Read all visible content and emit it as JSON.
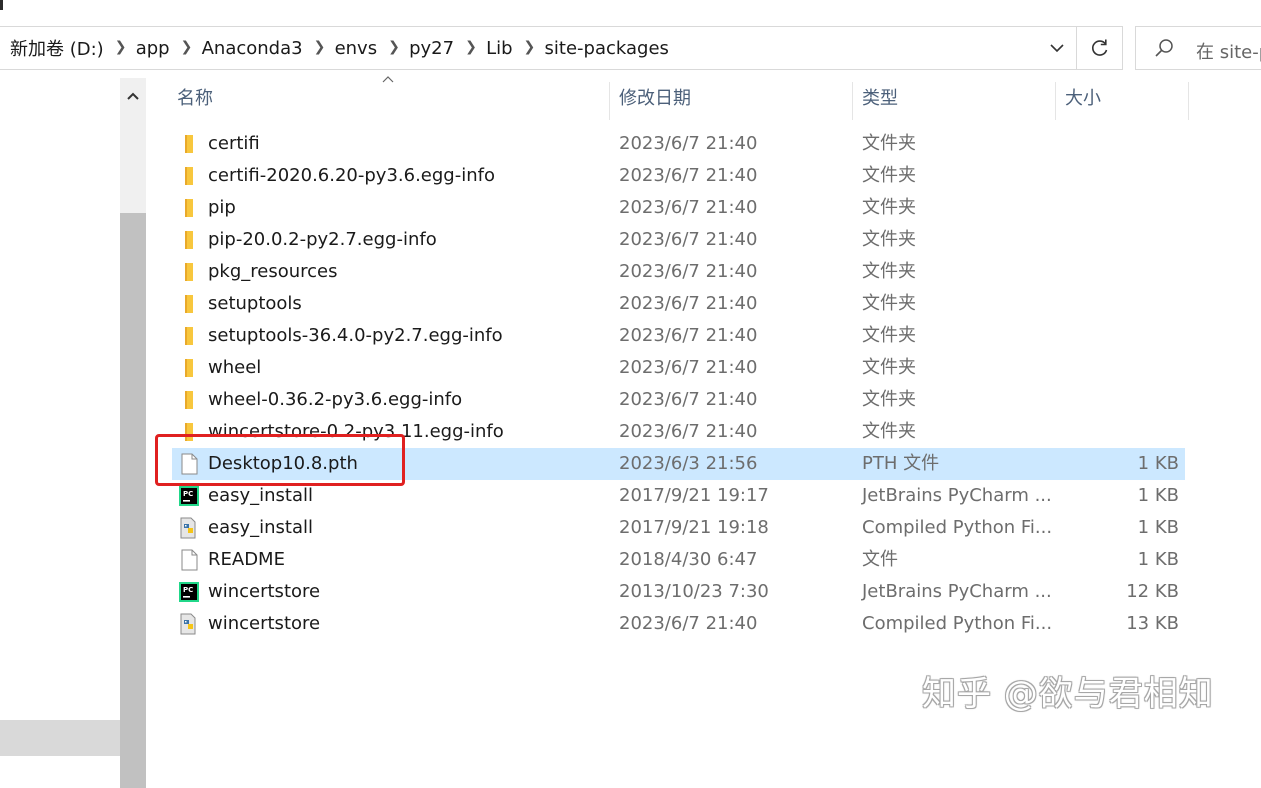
{
  "breadcrumb": [
    "新加卷 (D:)",
    "app",
    "Anaconda3",
    "envs",
    "py27",
    "Lib",
    "site-packages"
  ],
  "search": {
    "placeholder": "在 site-p"
  },
  "columns": {
    "name": "名称",
    "date": "修改日期",
    "type": "类型",
    "size": "大小"
  },
  "files": [
    {
      "name": "certifi",
      "date": "2023/6/7 21:40",
      "type": "文件夹",
      "size": "",
      "icon": "folder-icon"
    },
    {
      "name": "certifi-2020.6.20-py3.6.egg-info",
      "date": "2023/6/7 21:40",
      "type": "文件夹",
      "size": "",
      "icon": "folder-icon"
    },
    {
      "name": "pip",
      "date": "2023/6/7 21:40",
      "type": "文件夹",
      "size": "",
      "icon": "folder-icon"
    },
    {
      "name": "pip-20.0.2-py2.7.egg-info",
      "date": "2023/6/7 21:40",
      "type": "文件夹",
      "size": "",
      "icon": "folder-icon"
    },
    {
      "name": "pkg_resources",
      "date": "2023/6/7 21:40",
      "type": "文件夹",
      "size": "",
      "icon": "folder-icon"
    },
    {
      "name": "setuptools",
      "date": "2023/6/7 21:40",
      "type": "文件夹",
      "size": "",
      "icon": "folder-icon"
    },
    {
      "name": "setuptools-36.4.0-py2.7.egg-info",
      "date": "2023/6/7 21:40",
      "type": "文件夹",
      "size": "",
      "icon": "folder-icon"
    },
    {
      "name": "wheel",
      "date": "2023/6/7 21:40",
      "type": "文件夹",
      "size": "",
      "icon": "folder-icon"
    },
    {
      "name": "wheel-0.36.2-py3.6.egg-info",
      "date": "2023/6/7 21:40",
      "type": "文件夹",
      "size": "",
      "icon": "folder-icon"
    },
    {
      "name": "wincertstore-0.2-py3.11.egg-info",
      "date": "2023/6/7 21:40",
      "type": "文件夹",
      "size": "",
      "icon": "folder-icon"
    },
    {
      "name": "Desktop10.8.pth",
      "date": "2023/6/3 21:56",
      "type": "PTH 文件",
      "size": "1 KB",
      "icon": "file-icon",
      "selected": true
    },
    {
      "name": "easy_install",
      "date": "2017/9/21 19:17",
      "type": "JetBrains PyCharm ...",
      "size": "1 KB",
      "icon": "pycharm-icon"
    },
    {
      "name": "easy_install",
      "date": "2017/9/21 19:18",
      "type": "Compiled Python Fi...",
      "size": "1 KB",
      "icon": "python-compiled-icon"
    },
    {
      "name": "README",
      "date": "2018/4/30 6:47",
      "type": "文件",
      "size": "1 KB",
      "icon": "file-icon"
    },
    {
      "name": "wincertstore",
      "date": "2013/10/23 7:30",
      "type": "JetBrains PyCharm ...",
      "size": "12 KB",
      "icon": "pycharm-icon"
    },
    {
      "name": "wincertstore",
      "date": "2023/6/7 21:40",
      "type": "Compiled Python Fi...",
      "size": "13 KB",
      "icon": "python-compiled-icon"
    }
  ],
  "selected_index": 10,
  "watermark": "知乎 @欲与君相知",
  "colors": {
    "selection": "#cce8ff",
    "highlight_border": "#e02020",
    "folder": "#f8c73e"
  }
}
